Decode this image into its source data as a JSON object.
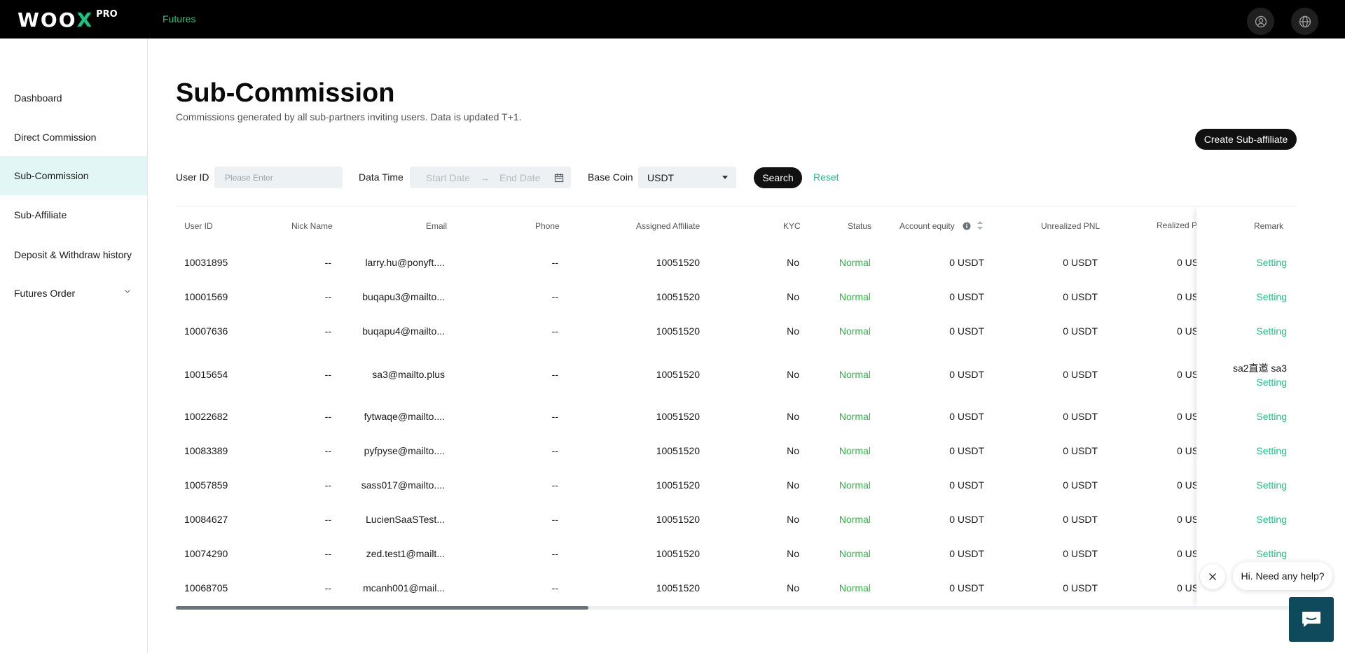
{
  "brand": {
    "name_left": "WOO",
    "name_x": "X",
    "badge": "PRO"
  },
  "header": {
    "nav_futures": "Futures"
  },
  "sidebar": {
    "items": [
      {
        "label": "Dashboard"
      },
      {
        "label": "Direct Commission"
      },
      {
        "label": "Sub-Commission"
      },
      {
        "label": "Sub-Affiliate"
      },
      {
        "label": "Deposit & Withdraw history"
      },
      {
        "label": "Futures Order"
      }
    ],
    "active": "Sub-Commission"
  },
  "page": {
    "title": "Sub-Commission",
    "subtitle": "Commissions generated by all sub-partners inviting users. Data is updated T+1.",
    "create_button": "Create Sub-affiliate"
  },
  "filters": {
    "user_id_label": "User ID",
    "user_id_placeholder": "Please Enter",
    "data_time_label": "Data Time",
    "start_date_placeholder": "Start Date",
    "range_separator": "→",
    "end_date_placeholder": "End Date",
    "base_coin_label": "Base Coin",
    "base_coin_value": "USDT",
    "search_button": "Search",
    "reset_link": "Reset"
  },
  "table": {
    "headers": {
      "user_id": "User ID",
      "nick_name": "Nick Name",
      "email": "Email",
      "phone": "Phone",
      "assigned_affiliate": "Assigned Affiliate",
      "kyc": "KYC",
      "status": "Status",
      "account_equity": "Account equity",
      "unrealized_pnl": "Unrealized PNL",
      "realized_pnl": "Realized PNL",
      "remark": "Remark"
    },
    "rows": [
      {
        "user_id": "10031895",
        "nick": "--",
        "email": "larry.hu@ponyft....",
        "phone": "--",
        "affiliate": "10051520",
        "kyc": "No",
        "status": "Normal",
        "equity": "0 USDT",
        "unrealized": "0 USDT",
        "realized": "0 US",
        "remark": "",
        "action": "Setting"
      },
      {
        "user_id": "10001569",
        "nick": "--",
        "email": "buqapu3@mailto...",
        "phone": "--",
        "affiliate": "10051520",
        "kyc": "No",
        "status": "Normal",
        "equity": "0 USDT",
        "unrealized": "0 USDT",
        "realized": "0 US",
        "remark": "",
        "action": "Setting"
      },
      {
        "user_id": "10007636",
        "nick": "--",
        "email": "buqapu4@mailto...",
        "phone": "--",
        "affiliate": "10051520",
        "kyc": "No",
        "status": "Normal",
        "equity": "0 USDT",
        "unrealized": "0 USDT",
        "realized": "0 US",
        "remark": "",
        "action": "Setting"
      },
      {
        "user_id": "10015654",
        "nick": "--",
        "email": "sa3@mailto.plus",
        "phone": "--",
        "affiliate": "10051520",
        "kyc": "No",
        "status": "Normal",
        "equity": "0 USDT",
        "unrealized": "0 USDT",
        "realized": "0 US",
        "remark": "sa2直邀 sa3",
        "action": "Setting"
      },
      {
        "user_id": "10022682",
        "nick": "--",
        "email": "fytwaqe@mailto....",
        "phone": "--",
        "affiliate": "10051520",
        "kyc": "No",
        "status": "Normal",
        "equity": "0 USDT",
        "unrealized": "0 USDT",
        "realized": "0 US",
        "remark": "",
        "action": "Setting"
      },
      {
        "user_id": "10083389",
        "nick": "--",
        "email": "pyfpyse@mailto....",
        "phone": "--",
        "affiliate": "10051520",
        "kyc": "No",
        "status": "Normal",
        "equity": "0 USDT",
        "unrealized": "0 USDT",
        "realized": "0 US",
        "remark": "",
        "action": "Setting"
      },
      {
        "user_id": "10057859",
        "nick": "--",
        "email": "sass017@mailto....",
        "phone": "--",
        "affiliate": "10051520",
        "kyc": "No",
        "status": "Normal",
        "equity": "0 USDT",
        "unrealized": "0 USDT",
        "realized": "0 US",
        "remark": "",
        "action": "Setting"
      },
      {
        "user_id": "10084627",
        "nick": "--",
        "email": "LucienSaaSTest...",
        "phone": "--",
        "affiliate": "10051520",
        "kyc": "No",
        "status": "Normal",
        "equity": "0 USDT",
        "unrealized": "0 USDT",
        "realized": "0 US",
        "remark": "",
        "action": "Setting"
      },
      {
        "user_id": "10074290",
        "nick": "--",
        "email": "zed.test1@mailt...",
        "phone": "--",
        "affiliate": "10051520",
        "kyc": "No",
        "status": "Normal",
        "equity": "0 USDT",
        "unrealized": "0 USDT",
        "realized": "0 US",
        "remark": "",
        "action": "Setting"
      },
      {
        "user_id": "10068705",
        "nick": "--",
        "email": "mcanh001@mail...",
        "phone": "--",
        "affiliate": "10051520",
        "kyc": "No",
        "status": "Normal",
        "equity": "0 USDT",
        "unrealized": "0 USDT",
        "realized": "0 US",
        "remark": "",
        "action": ""
      }
    ],
    "horizontal_scroll_fraction": 0.3
  },
  "chat": {
    "bubble_text": "Hi. Need any help?"
  },
  "colors": {
    "accent": "#16c784",
    "status_normal": "#2fb344",
    "dark": "#111111"
  },
  "icons": [
    "user-icon",
    "globe-icon",
    "chevron-down-icon",
    "calendar-icon",
    "caret-down-icon",
    "info-icon",
    "sort-icon",
    "close-icon",
    "chat-icon"
  ]
}
